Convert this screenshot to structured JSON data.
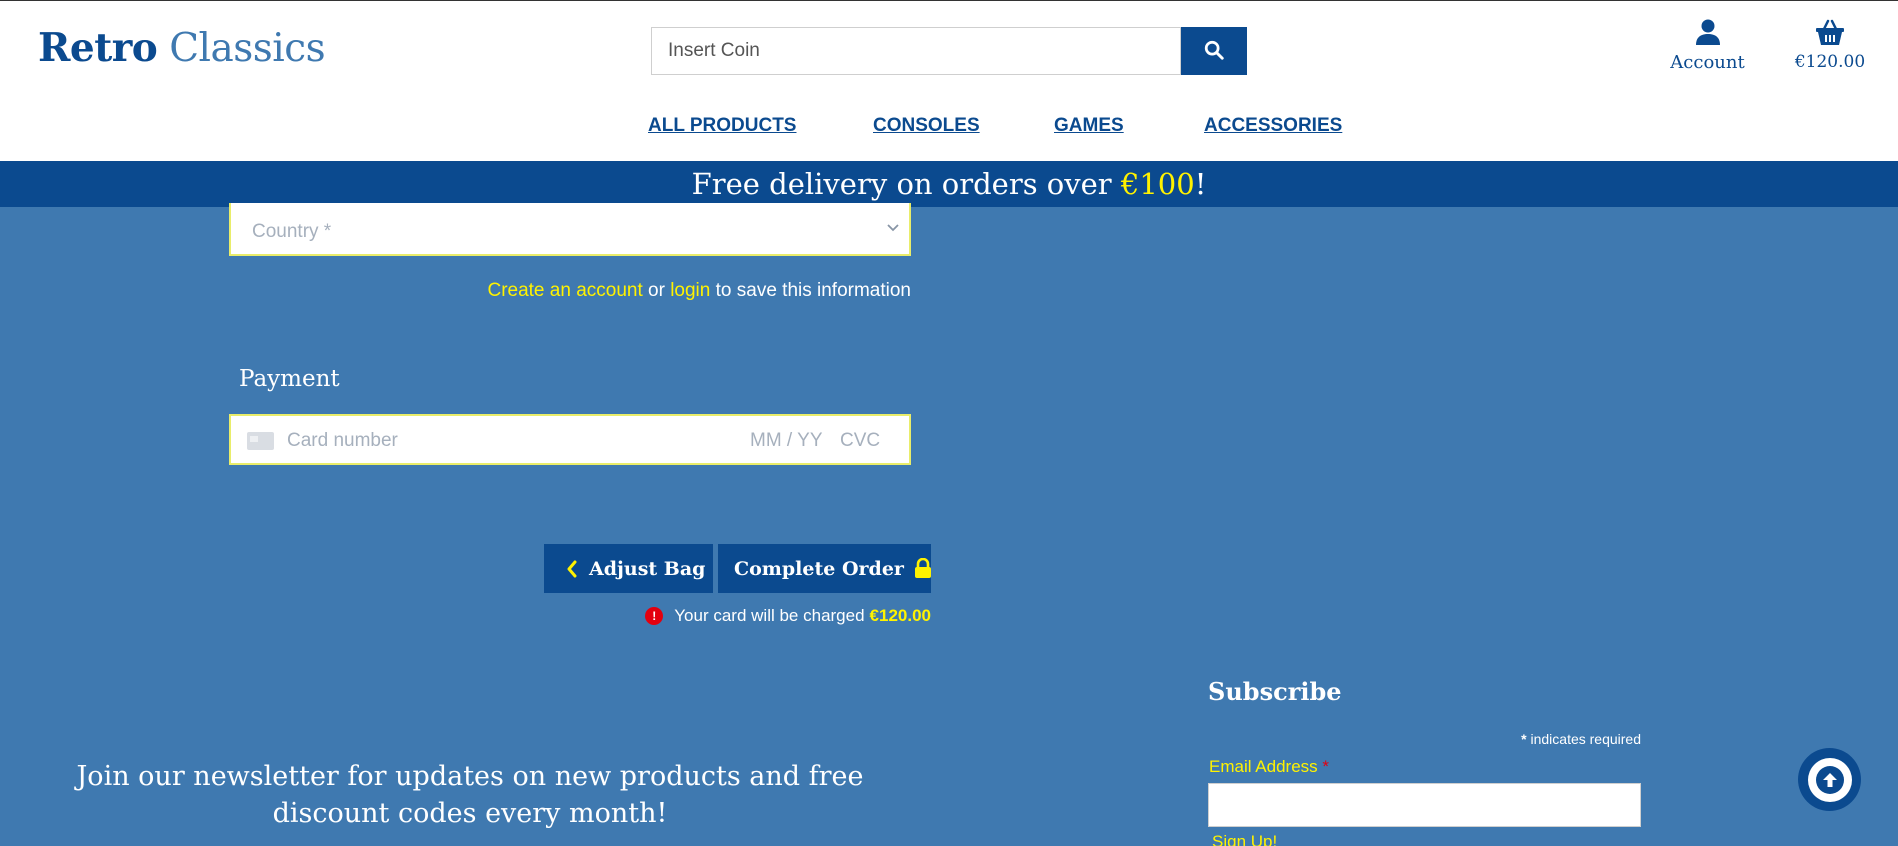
{
  "header": {
    "brand_bold": "Retro",
    "brand_light": "Classics",
    "search_placeholder": "Insert Coin",
    "account_label": "Account",
    "basket_total": "€120.00"
  },
  "nav": {
    "all_products": "ALL PRODUCTS",
    "consoles": "CONSOLES",
    "games": "GAMES",
    "accessories": "ACCESSORIES"
  },
  "banner": {
    "text_before": "Free delivery on orders over ",
    "highlight": "€100",
    "text_after": "!"
  },
  "checkout": {
    "country_placeholder": "Country *",
    "create_account_link": "Create an account",
    "or_text": " or ",
    "login_link": "login",
    "save_text": " to save this information",
    "payment_heading": "Payment",
    "card_number_placeholder": "Card number",
    "expiry_placeholder": "MM / YY",
    "cvc_placeholder": "CVC",
    "adjust_bag_label": "Adjust Bag",
    "complete_order_label": "Complete Order",
    "charge_text": "Your card will be charged",
    "charge_amount": "€120.00",
    "alert_glyph": "!"
  },
  "footer": {
    "newsletter_text": "Join our newsletter for updates on new products and free discount codes every month!",
    "subscribe_heading": "Subscribe",
    "required_star": "*",
    "required_text": " indicates required",
    "email_label": "Email Address",
    "email_star": "*",
    "signup_label": "Sign Up!"
  },
  "colors": {
    "brand_blue": "#0b4a8f",
    "page_blue": "#3f79b0",
    "accent_yellow": "#fff200",
    "error_red": "#e3000f"
  },
  "icons": {
    "search": "search-icon",
    "account": "user-icon",
    "basket": "basket-icon",
    "adjust": "chevron-left-icon",
    "complete": "lock-icon",
    "alert": "alert-circle-icon",
    "card": "credit-card-icon",
    "back_to_top": "arrow-up-icon"
  }
}
